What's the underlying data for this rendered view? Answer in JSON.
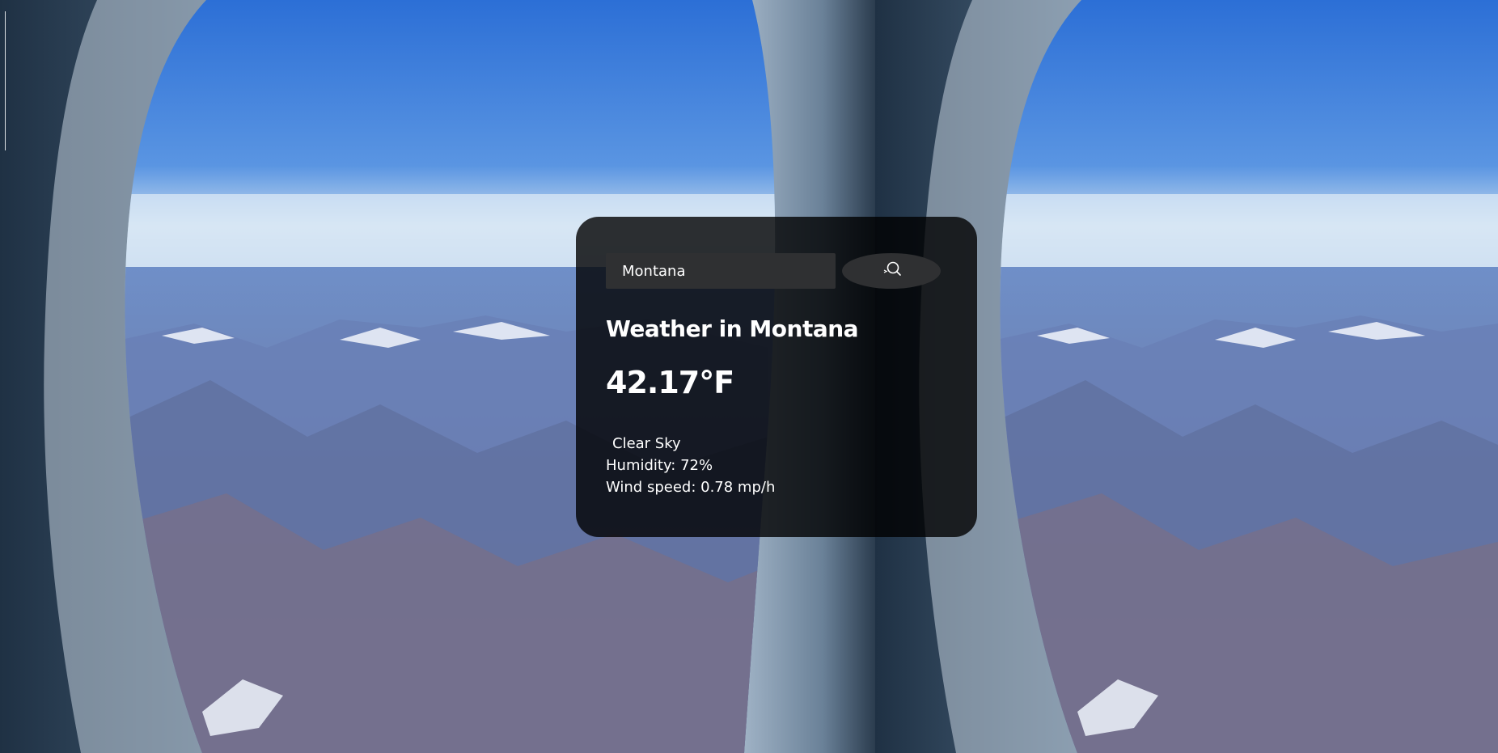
{
  "search": {
    "value": "Montana",
    "placeholder": "Search"
  },
  "weather": {
    "title": "Weather in Montana",
    "temperature": "42.17°F",
    "description": "Clear Sky",
    "humidity": "Humidity: 72%",
    "wind": "Wind speed: 0.78 mp/h"
  },
  "icons": {
    "search_button": "magnifying-glass-icon"
  },
  "background": {
    "image": "airplane-window-mountains-photo"
  }
}
